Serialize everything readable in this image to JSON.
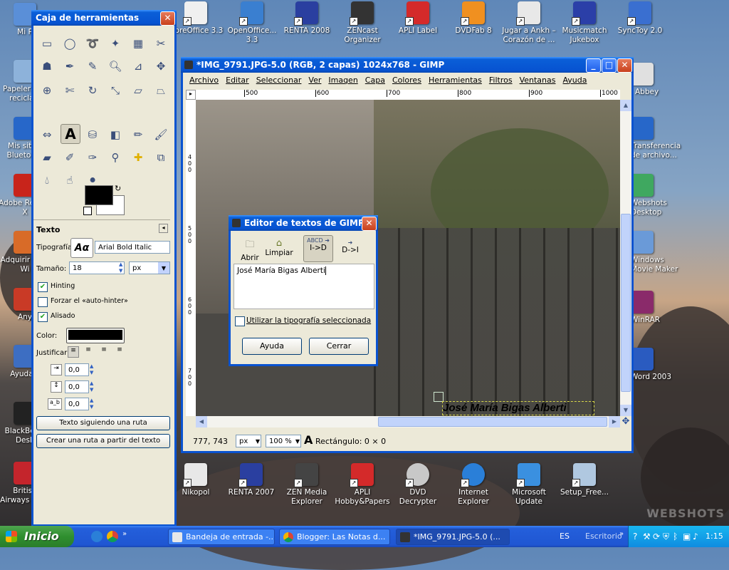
{
  "desktop": {
    "left_icons": [
      {
        "label": "Mi P",
        "color": "#5a8fd8"
      },
      {
        "label": "Papelera de reciclaje",
        "color": "#8db2da"
      },
      {
        "label": "Mis sitios Bluetooth",
        "color": "#2767c9"
      },
      {
        "label": "Adobe Reader X",
        "color": "#c8241b"
      },
      {
        "label": "Adquirir para Wi",
        "color": "#d86b28"
      },
      {
        "label": "Any",
        "color": "#c93a26"
      },
      {
        "label": "Ayuda c",
        "color": "#3d6ec2"
      },
      {
        "label": "BlackBerry Desk",
        "color": "#222222"
      },
      {
        "label": "British Airways Fligh",
        "color": "#c4252c"
      }
    ],
    "top_icons": [
      {
        "label": "LibreOffice 3.3",
        "color": "#f0f0f0"
      },
      {
        "label": "OpenOffice... 3.3",
        "color": "#3a7fd0"
      },
      {
        "label": "RENTA 2008",
        "color": "#2a3fa0"
      },
      {
        "label": "ZENcast Organizer",
        "color": "#333333"
      },
      {
        "label": "APLI Label",
        "color": "#d42a2a"
      },
      {
        "label": "DVDFab 8",
        "color": "#f09020"
      },
      {
        "label": "Jugar a Ankh – Corazón de ...",
        "color": "#e8e8e8"
      },
      {
        "label": "Musicmatch Jukebox",
        "color": "#2b3fa8"
      },
      {
        "label": "SyncToy 2.0",
        "color": "#3a6fd0"
      }
    ],
    "right_icons": [
      {
        "label": "Abbey",
        "color": "#e0e0e0"
      },
      {
        "label": "Transferencia de archivo...",
        "color": "#2767c9"
      },
      {
        "label": "Webshots Desktop",
        "color": "#3fa860"
      },
      {
        "label": "Windows Movie Maker",
        "color": "#6a9ad8"
      },
      {
        "label": "WinRAR",
        "color": "#8a2a6a"
      },
      {
        "label": "Word 2003",
        "color": "#2a5bc0"
      }
    ],
    "bottom_icons": [
      {
        "label": "Nikopol",
        "color": "#e8e8e8"
      },
      {
        "label": "RENTA 2007",
        "color": "#2a3fa0"
      },
      {
        "label": "ZEN Media Explorer",
        "color": "#444444"
      },
      {
        "label": "APLI Hobby&Papers",
        "color": "#d42a2a"
      },
      {
        "label": "DVD Decrypter",
        "color": "#c8c8c8"
      },
      {
        "label": "Internet Explorer",
        "color": "#2a7fd8"
      },
      {
        "label": "Microsoft Update",
        "color": "#3a90e0"
      },
      {
        "label": "Setup_Free...",
        "color": "#b0c8e0"
      }
    ],
    "watermark": "WEBSHOTS"
  },
  "toolbox": {
    "title": "Caja de herramientas",
    "section_title": "Texto",
    "font_label": "Tipografía:",
    "font_preview": "Aα",
    "font_value": "Arial Bold Italic",
    "size_label": "Tamaño:",
    "size_value": "18",
    "unit_value": "px",
    "hinting_label": "Hinting",
    "autohinter_label": "Forzar el «auto-hinter»",
    "antialias_label": "Alisado",
    "color_label": "Color:",
    "color_value": "#000000",
    "justify_label": "Justificar:",
    "indent_value": "0,0",
    "line_spacing_value": "0,0",
    "letter_spacing_value": "0,0",
    "path_button": "Texto siguiendo una ruta",
    "create_path_button": "Crear una ruta a partir del texto"
  },
  "gimp": {
    "title": "*IMG_9791.JPG-5.0 (RGB, 2 capas) 1024x768 - GIMP",
    "menu": [
      "Archivo",
      "Editar",
      "Seleccionar",
      "Ver",
      "Imagen",
      "Capa",
      "Colores",
      "Herramientas",
      "Filtros",
      "Ventanas",
      "Ayuda"
    ],
    "ruler_h": [
      "500",
      "600",
      "700",
      "800",
      "900",
      "1000"
    ],
    "ruler_v": [
      "4\n0\n0",
      "5\n0\n0",
      "6\n0\n0",
      "7\n0\n0"
    ],
    "canvas_text": "José María Bigas Alberti",
    "status_coords": "777, 743",
    "status_unit": "px",
    "status_zoom": "100 %",
    "status_message": "Rectángulo: 0 × 0"
  },
  "dialog": {
    "title": "Editor de textos de GIMP",
    "open_label": "Abrir",
    "clear_label": "Limpiar",
    "ltr_label": "I->D",
    "rtl_label": "D->I",
    "text": "José María Bigas Alberti",
    "use_font_label": "Utilizar la tipografía seleccionada",
    "help_button": "Ayuda",
    "close_button": "Cerrar"
  },
  "taskbar": {
    "start_label": "Inicio",
    "tasks": [
      {
        "label": "Bandeja de entrada -..."
      },
      {
        "label": "Blogger: Las Notas d..."
      },
      {
        "label": "*IMG_9791.JPG-5.0 (..."
      }
    ],
    "language": "ES",
    "desktop_label": "Escritorio",
    "clock": "1:15"
  }
}
